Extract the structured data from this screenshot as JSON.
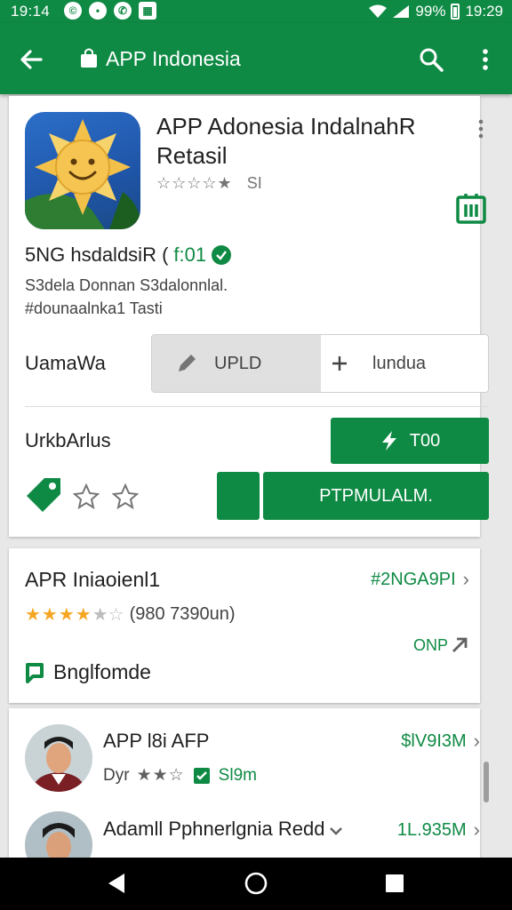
{
  "status_bar": {
    "time_left": "19:14",
    "battery": "99%",
    "time_right": "19:29"
  },
  "app_bar": {
    "title": "APP Indonesia"
  },
  "app": {
    "title": "APP Adonesia IndalnahR Retasil",
    "rating_stars": "☆☆☆☆★",
    "rating_count": "SI",
    "developer": "5NG hsdaldsiR (",
    "developer_code": "f:01",
    "desc_line1": "S3dela Donnan S3dalonnlal.",
    "desc_line2": "#dounaalnka1 Tasti"
  },
  "rows": {
    "row1_label": "UamaWa",
    "seg_left_label": "UPLD",
    "seg_right_label": "lundua",
    "row2_label": "UrkbArlus",
    "btn_top_label": "T00",
    "btn_main_label": "PTPMULALM."
  },
  "card2": {
    "title": "APR Iniaoienl1",
    "link": "#2NGA9PI",
    "stars": "★★★★",
    "half_stars": "★☆",
    "rating_count": "(980 7390un)",
    "side_text": "ONP",
    "link2": "Bnglfomde"
  },
  "list": [
    {
      "title": "APP l8i AFP",
      "sub_prefix": "Dyr",
      "sub_stars": "★★☆",
      "sub_tag": "Sl9m",
      "price": "$lV9I3M"
    },
    {
      "title": "Adamll Pphnerlgnia Redd",
      "price": "1L.935M"
    }
  ],
  "colors": {
    "brand_green": "#0f8a44",
    "star_gold": "#f5a623"
  }
}
